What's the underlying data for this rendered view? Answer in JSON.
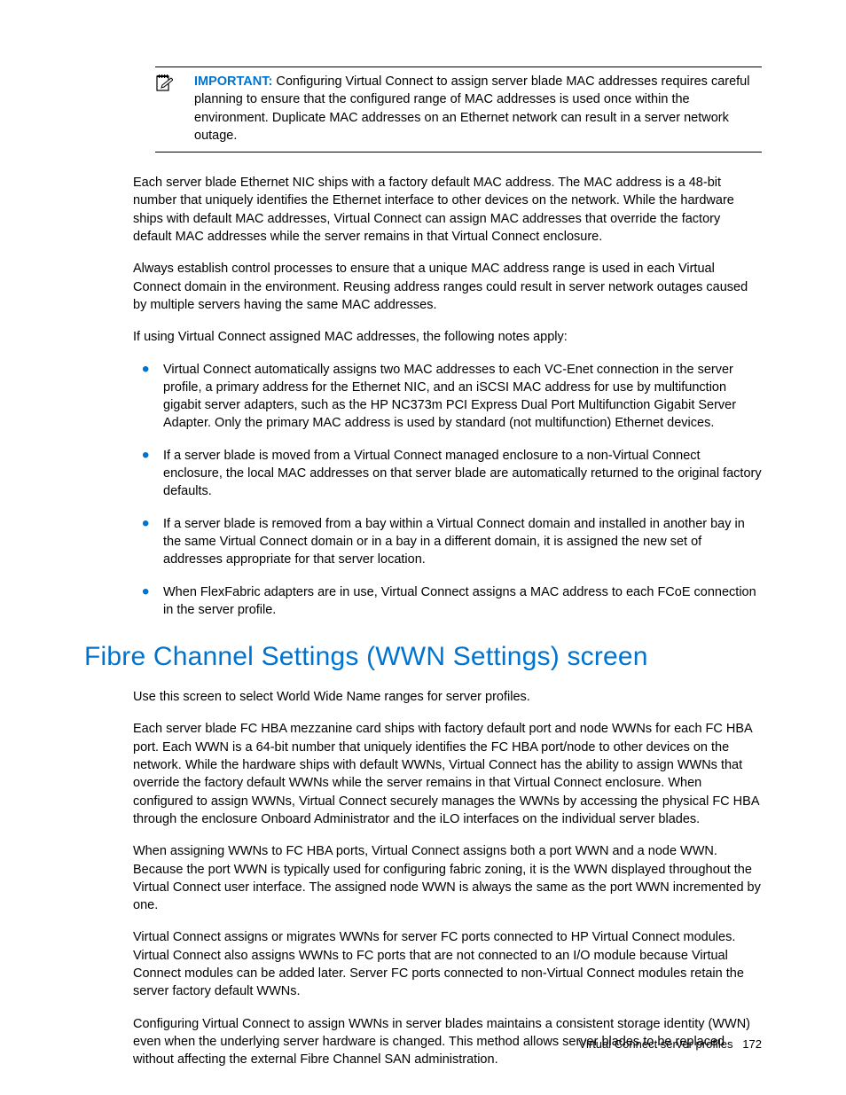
{
  "important": {
    "label": "IMPORTANT:",
    "text": "Configuring Virtual Connect to assign server blade MAC addresses requires careful planning to ensure that the configured range of MAC addresses is used once within the environment. Duplicate MAC addresses on an Ethernet network can result in a server network outage."
  },
  "paragraphs_top": [
    "Each server blade Ethernet NIC ships with a factory default MAC address. The MAC address is a 48-bit number that uniquely identifies the Ethernet interface to other devices on the network. While the hardware ships with default MAC addresses, Virtual Connect can assign MAC addresses that override the factory default MAC addresses while the server remains in that Virtual Connect enclosure.",
    "Always establish control processes to ensure that a unique MAC address range is used in each Virtual Connect domain in the environment. Reusing address ranges could result in server network outages caused by multiple servers having the same MAC addresses.",
    "If using Virtual Connect assigned MAC addresses, the following notes apply:"
  ],
  "bullets": [
    "Virtual Connect automatically assigns two MAC addresses to each VC-Enet connection in the server profile, a primary address for the Ethernet NIC, and an iSCSI MAC address for use by multifunction gigabit server adapters, such as the HP NC373m PCI Express Dual Port Multifunction Gigabit Server Adapter. Only the primary MAC address is used by standard (not multifunction) Ethernet devices.",
    "If a server blade is moved from a Virtual Connect managed enclosure to a non-Virtual Connect enclosure, the local MAC addresses on that server blade are automatically returned to the original factory defaults.",
    "If a server blade is removed from a bay within a Virtual Connect domain and installed in another bay in the same Virtual Connect domain or in a bay in a different domain, it is assigned the new set of addresses appropriate for that server location.",
    "When FlexFabric adapters are in use, Virtual Connect assigns a MAC address to each FCoE connection in the server profile."
  ],
  "section_title": "Fibre Channel Settings (WWN Settings) screen",
  "paragraphs_bottom": [
    "Use this screen to select World Wide Name ranges for server profiles.",
    "Each server blade FC HBA mezzanine card ships with factory default port and node WWNs for each FC HBA port. Each WWN is a 64-bit number that uniquely identifies the FC HBA port/node to other devices on the network. While the hardware ships with default WWNs, Virtual Connect has the ability to assign WWNs that override the factory default WWNs while the server remains in that Virtual Connect enclosure. When configured to assign WWNs, Virtual Connect securely manages the WWNs by accessing the physical FC HBA through the enclosure Onboard Administrator and the iLO interfaces on the individual server blades.",
    "When assigning WWNs to FC HBA ports, Virtual Connect assigns both a port WWN and a node WWN. Because the port WWN is typically used for configuring fabric zoning, it is the WWN displayed throughout the Virtual Connect user interface. The assigned node WWN is always the same as the port WWN incremented by one.",
    "Virtual Connect assigns or migrates WWNs for server FC ports connected to HP Virtual Connect modules. Virtual Connect also assigns WWNs to FC ports that are not connected to an I/O module because Virtual Connect modules can be added later. Server FC ports connected to non-Virtual Connect modules retain the server factory default WWNs.",
    "Configuring Virtual Connect to assign WWNs in server blades maintains a consistent storage identity (WWN) even when the underlying server hardware is changed. This method allows server blades to be replaced without affecting the external Fibre Channel SAN administration."
  ],
  "footer": {
    "section": "Virtual Connect server profiles",
    "page": "172"
  }
}
